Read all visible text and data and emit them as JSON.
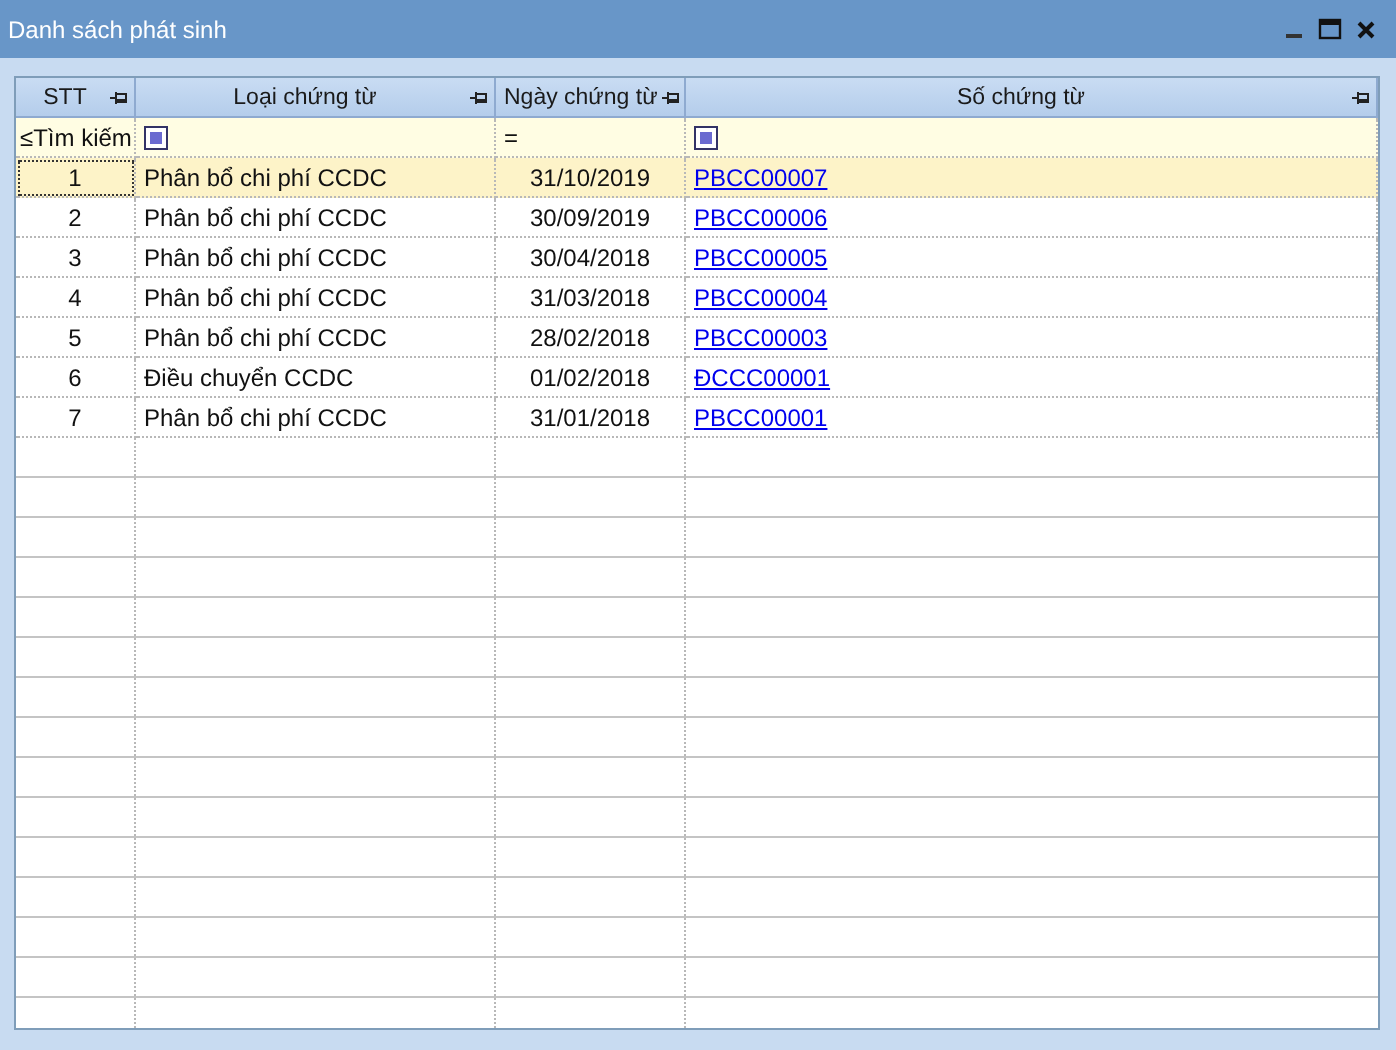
{
  "window": {
    "title": "Danh sách phát sinh"
  },
  "table": {
    "columns": [
      {
        "label": "STT"
      },
      {
        "label": "Loại chứng từ"
      },
      {
        "label": "Ngày chứng từ"
      },
      {
        "label": "Số chứng từ"
      }
    ],
    "filter_row": {
      "search_label": "≤Tìm kiếm",
      "operator": "=",
      "type_filter": {
        "checked": true
      },
      "number_filter": {
        "checked": true
      }
    },
    "rows": [
      {
        "stt": "1",
        "type": "Phân bổ chi phí CCDC",
        "date": "31/10/2019",
        "number": "PBCC00007",
        "selected": true
      },
      {
        "stt": "2",
        "type": "Phân bổ chi phí CCDC",
        "date": "30/09/2019",
        "number": "PBCC00006",
        "selected": false
      },
      {
        "stt": "3",
        "type": "Phân bổ chi phí CCDC",
        "date": "30/04/2018",
        "number": "PBCC00005",
        "selected": false
      },
      {
        "stt": "4",
        "type": "Phân bổ chi phí CCDC",
        "date": "31/03/2018",
        "number": "PBCC00004",
        "selected": false
      },
      {
        "stt": "5",
        "type": "Phân bổ chi phí CCDC",
        "date": "28/02/2018",
        "number": "PBCC00003",
        "selected": false
      },
      {
        "stt": "6",
        "type": "Điều chuyển CCDC",
        "date": "01/02/2018",
        "number": "ĐCCC00001",
        "selected": false
      },
      {
        "stt": "7",
        "type": "Phân bổ chi phí CCDC",
        "date": "31/01/2018",
        "number": "PBCC00001",
        "selected": false
      }
    ]
  }
}
